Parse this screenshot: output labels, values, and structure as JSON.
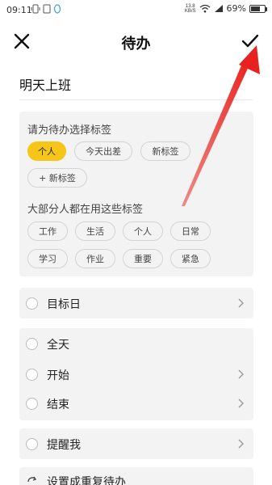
{
  "status_bar": {
    "time": "09:11",
    "net_speed_top": "13.8",
    "net_speed_unit": "KB/S",
    "battery": "69%",
    "battery_level": 0.69
  },
  "header": {
    "title": "待办"
  },
  "todo": {
    "title": "明天上班"
  },
  "tags_section": {
    "prompt": "请为待办选择标签",
    "chips": [
      "个人",
      "今天出差",
      "新标签"
    ],
    "selected_chip": "个人",
    "add_label": "+ 新标签",
    "popular_prompt": "大部分人都在用这些标签",
    "popular_chips": [
      "工作",
      "生活",
      "个人",
      "日常",
      "学习",
      "作业",
      "重要",
      "紧急"
    ]
  },
  "rows": {
    "target_day": "目标日",
    "all_day": "全天",
    "start": "开始",
    "end": "结束",
    "remind": "提醒我",
    "repeat": "设置成重复待办"
  },
  "colors": {
    "accent": "#f5c518",
    "annotation_arrow": "#e8231f",
    "card_bg": "#f3f3f3"
  }
}
